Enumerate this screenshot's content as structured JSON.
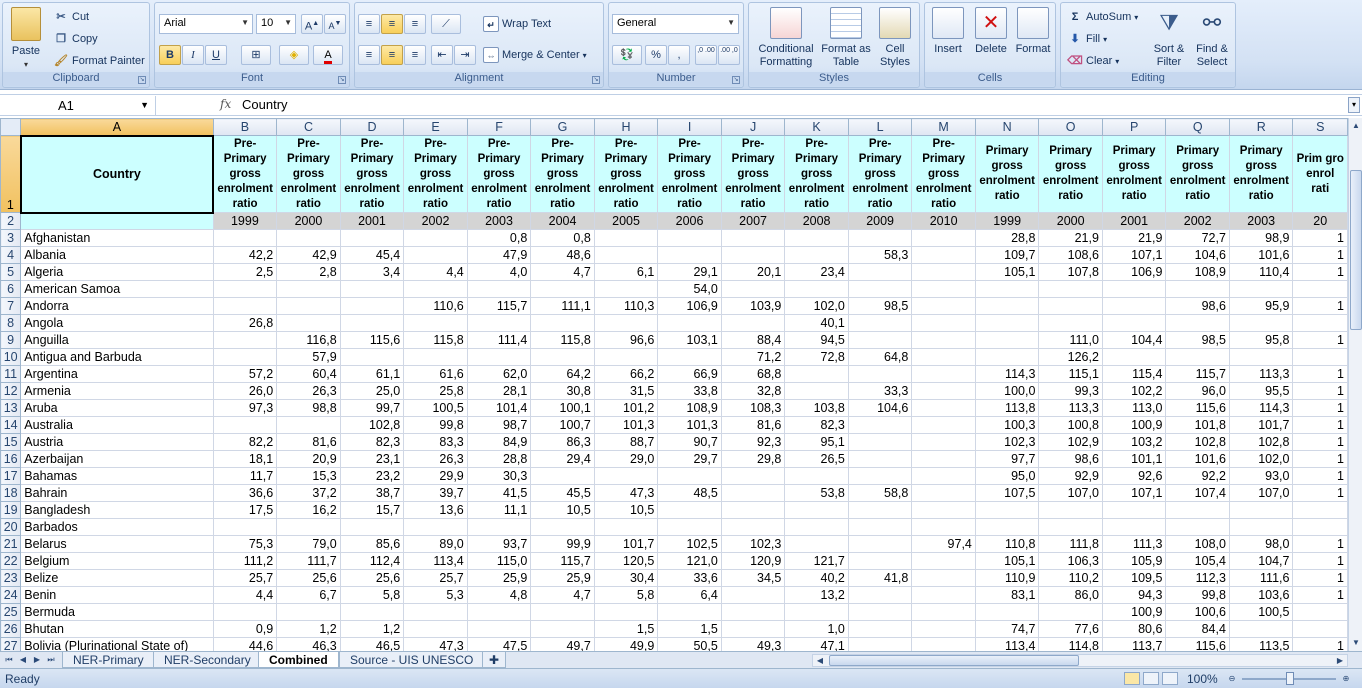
{
  "ribbon": {
    "clipboard": {
      "label": "Clipboard",
      "paste": "Paste",
      "cut": "Cut",
      "copy": "Copy",
      "format_painter": "Format Painter"
    },
    "font": {
      "label": "Font",
      "family": "Arial",
      "size": "10",
      "bold": "B",
      "italic": "I",
      "underline": "U",
      "grow": "A",
      "shrink": "A"
    },
    "alignment": {
      "label": "Alignment",
      "wrap_text": "Wrap Text",
      "merge_center": "Merge & Center"
    },
    "number": {
      "label": "Number",
      "format": "General",
      "percent": "%",
      "comma": ",",
      "inc_dec": ",0 .00",
      "dec_dec": ".00 ,0"
    },
    "styles": {
      "label": "Styles",
      "conditional": "Conditional Formatting",
      "format_table": "Format as Table",
      "cell_styles": "Cell Styles"
    },
    "cells": {
      "label": "Cells",
      "insert": "Insert",
      "delete": "Delete",
      "format": "Format"
    },
    "editing": {
      "label": "Editing",
      "autosum": "AutoSum",
      "fill": "Fill",
      "clear": "Clear",
      "sort_filter": "Sort & Filter",
      "find_select": "Find & Select"
    }
  },
  "formula_bar": {
    "name_box": "A1",
    "fx": "fx",
    "value": "Country"
  },
  "grid": {
    "columns": [
      "A",
      "B",
      "C",
      "D",
      "E",
      "F",
      "G",
      "H",
      "I",
      "J",
      "K",
      "L",
      "M",
      "N",
      "O",
      "P",
      "Q",
      "R",
      "S"
    ],
    "header_country": "Country",
    "header_pre": "Pre-Primary gross enrolment ratio",
    "header_primary": "Primary gross enrolment ratio",
    "header_last": "Prim gro enrol rati",
    "years": [
      "1999",
      "2000",
      "2001",
      "2002",
      "2003",
      "2004",
      "2005",
      "2006",
      "2007",
      "2008",
      "2009",
      "2010",
      "1999",
      "2000",
      "2001",
      "2002",
      "2003",
      "20"
    ],
    "rows": [
      {
        "n": "3",
        "c": "Afghanistan",
        "v": [
          "",
          "",
          "",
          "",
          "0,8",
          "0,8",
          "",
          "",
          "",
          "",
          "",
          "",
          "28,8",
          "21,9",
          "21,9",
          "72,7",
          "98,9",
          "1"
        ]
      },
      {
        "n": "4",
        "c": "Albania",
        "v": [
          "42,2",
          "42,9",
          "45,4",
          "",
          "47,9",
          "48,6",
          "",
          "",
          "",
          "",
          "58,3",
          "",
          "109,7",
          "108,6",
          "107,1",
          "104,6",
          "101,6",
          "1"
        ]
      },
      {
        "n": "5",
        "c": "Algeria",
        "v": [
          "2,5",
          "2,8",
          "3,4",
          "4,4",
          "4,0",
          "4,7",
          "6,1",
          "29,1",
          "20,1",
          "23,4",
          "",
          "",
          "105,1",
          "107,8",
          "106,9",
          "108,9",
          "110,4",
          "1"
        ]
      },
      {
        "n": "6",
        "c": "American Samoa",
        "v": [
          "",
          "",
          "",
          "",
          "",
          "",
          "",
          "54,0",
          "",
          "",
          "",
          "",
          "",
          "",
          "",
          "",
          "",
          ""
        ]
      },
      {
        "n": "7",
        "c": "Andorra",
        "v": [
          "",
          "",
          "",
          "110,6",
          "115,7",
          "111,1",
          "110,3",
          "106,9",
          "103,9",
          "102,0",
          "98,5",
          "",
          "",
          "",
          "",
          "98,6",
          "95,9",
          "1"
        ]
      },
      {
        "n": "8",
        "c": "Angola",
        "v": [
          "26,8",
          "",
          "",
          "",
          "",
          "",
          "",
          "",
          "",
          "40,1",
          "",
          "",
          "",
          "",
          "",
          "",
          "",
          ""
        ]
      },
      {
        "n": "9",
        "c": "Anguilla",
        "v": [
          "",
          "116,8",
          "115,6",
          "115,8",
          "111,4",
          "115,8",
          "96,6",
          "103,1",
          "88,4",
          "94,5",
          "",
          "",
          "",
          "111,0",
          "104,4",
          "98,5",
          "95,8",
          "1"
        ]
      },
      {
        "n": "10",
        "c": "Antigua and Barbuda",
        "v": [
          "",
          "57,9",
          "",
          "",
          "",
          "",
          "",
          "",
          "71,2",
          "72,8",
          "64,8",
          "",
          "",
          "126,2",
          "",
          "",
          "",
          ""
        ]
      },
      {
        "n": "11",
        "c": "Argentina",
        "v": [
          "57,2",
          "60,4",
          "61,1",
          "61,6",
          "62,0",
          "64,2",
          "66,2",
          "66,9",
          "68,8",
          "",
          "",
          "",
          "114,3",
          "115,1",
          "115,4",
          "115,7",
          "113,3",
          "1"
        ]
      },
      {
        "n": "12",
        "c": "Armenia",
        "v": [
          "26,0",
          "26,3",
          "25,0",
          "25,8",
          "28,1",
          "30,8",
          "31,5",
          "33,8",
          "32,8",
          "",
          "33,3",
          "",
          "100,0",
          "99,3",
          "102,2",
          "96,0",
          "95,5",
          "1"
        ]
      },
      {
        "n": "13",
        "c": "Aruba",
        "v": [
          "97,3",
          "98,8",
          "99,7",
          "100,5",
          "101,4",
          "100,1",
          "101,2",
          "108,9",
          "108,3",
          "103,8",
          "104,6",
          "",
          "113,8",
          "113,3",
          "113,0",
          "115,6",
          "114,3",
          "1"
        ]
      },
      {
        "n": "14",
        "c": "Australia",
        "v": [
          "",
          "",
          "102,8",
          "99,8",
          "98,7",
          "100,7",
          "101,3",
          "101,3",
          "81,6",
          "82,3",
          "",
          "",
          "100,3",
          "100,8",
          "100,9",
          "101,8",
          "101,7",
          "1"
        ]
      },
      {
        "n": "15",
        "c": "Austria",
        "v": [
          "82,2",
          "81,6",
          "82,3",
          "83,3",
          "84,9",
          "86,3",
          "88,7",
          "90,7",
          "92,3",
          "95,1",
          "",
          "",
          "102,3",
          "102,9",
          "103,2",
          "102,8",
          "102,8",
          "1"
        ]
      },
      {
        "n": "16",
        "c": "Azerbaijan",
        "v": [
          "18,1",
          "20,9",
          "23,1",
          "26,3",
          "28,8",
          "29,4",
          "29,0",
          "29,7",
          "29,8",
          "26,5",
          "",
          "",
          "97,7",
          "98,6",
          "101,1",
          "101,6",
          "102,0",
          "1"
        ]
      },
      {
        "n": "17",
        "c": "Bahamas",
        "v": [
          "11,7",
          "15,3",
          "23,2",
          "29,9",
          "30,3",
          "",
          "",
          "",
          "",
          "",
          "",
          "",
          "95,0",
          "92,9",
          "92,6",
          "92,2",
          "93,0",
          "1"
        ]
      },
      {
        "n": "18",
        "c": "Bahrain",
        "v": [
          "36,6",
          "37,2",
          "38,7",
          "39,7",
          "41,5",
          "45,5",
          "47,3",
          "48,5",
          "",
          "53,8",
          "58,8",
          "",
          "107,5",
          "107,0",
          "107,1",
          "107,4",
          "107,0",
          "1"
        ]
      },
      {
        "n": "19",
        "c": "Bangladesh",
        "v": [
          "17,5",
          "16,2",
          "15,7",
          "13,6",
          "11,1",
          "10,5",
          "10,5",
          "",
          "",
          "",
          "",
          "",
          "",
          "",
          "",
          "",
          "",
          ""
        ]
      },
      {
        "n": "20",
        "c": "Barbados",
        "v": [
          "",
          "",
          "",
          "",
          "",
          "",
          "",
          "",
          "",
          "",
          "",
          "",
          "",
          "",
          "",
          "",
          "",
          ""
        ]
      },
      {
        "n": "21",
        "c": "Belarus",
        "v": [
          "75,3",
          "79,0",
          "85,6",
          "89,0",
          "93,7",
          "99,9",
          "101,7",
          "102,5",
          "102,3",
          "",
          "",
          "97,4",
          "110,8",
          "111,8",
          "111,3",
          "108,0",
          "98,0",
          "1"
        ]
      },
      {
        "n": "22",
        "c": "Belgium",
        "v": [
          "111,2",
          "111,7",
          "112,4",
          "113,4",
          "115,0",
          "115,7",
          "120,5",
          "121,0",
          "120,9",
          "121,7",
          "",
          "",
          "105,1",
          "106,3",
          "105,9",
          "105,4",
          "104,7",
          "1"
        ]
      },
      {
        "n": "23",
        "c": "Belize",
        "v": [
          "25,7",
          "25,6",
          "25,6",
          "25,7",
          "25,9",
          "25,9",
          "30,4",
          "33,6",
          "34,5",
          "40,2",
          "41,8",
          "",
          "110,9",
          "110,2",
          "109,5",
          "112,3",
          "111,6",
          "1"
        ]
      },
      {
        "n": "24",
        "c": "Benin",
        "v": [
          "4,4",
          "6,7",
          "5,8",
          "5,3",
          "4,8",
          "4,7",
          "5,8",
          "6,4",
          "",
          "13,2",
          "",
          "",
          "83,1",
          "86,0",
          "94,3",
          "99,8",
          "103,6",
          "1"
        ]
      },
      {
        "n": "25",
        "c": "Bermuda",
        "v": [
          "",
          "",
          "",
          "",
          "",
          "",
          "",
          "",
          "",
          "",
          "",
          "",
          "",
          "",
          "100,9",
          "100,6",
          "100,5",
          ""
        ]
      },
      {
        "n": "26",
        "c": "Bhutan",
        "v": [
          "0,9",
          "1,2",
          "1,2",
          "",
          "",
          "",
          "1,5",
          "1,5",
          "",
          "1,0",
          "",
          "",
          "74,7",
          "77,6",
          "80,6",
          "84,4",
          "",
          ""
        ]
      },
      {
        "n": "27",
        "c": "Bolivia (Plurinational State of)",
        "v": [
          "44,6",
          "46,3",
          "46,5",
          "47,3",
          "47,5",
          "49,7",
          "49,9",
          "50,5",
          "49,3",
          "47,1",
          "",
          "",
          "113,4",
          "114,8",
          "113,7",
          "115,6",
          "113,5",
          "1"
        ]
      }
    ]
  },
  "sheet_tabs": [
    "NER-Primary",
    "NER-Secondary",
    "Combined",
    "Source - UIS UNESCO"
  ],
  "active_tab": "Combined",
  "status": {
    "text": "Ready",
    "zoom": "100%"
  }
}
